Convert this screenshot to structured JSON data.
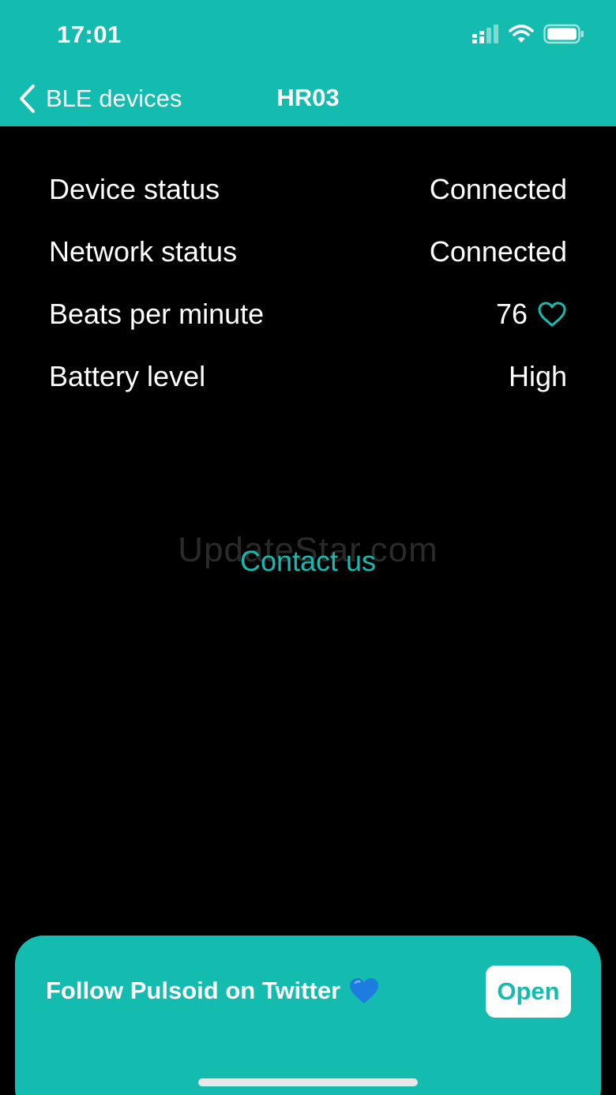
{
  "status_bar": {
    "time": "17:01",
    "icons": [
      "cellular-signal-icon",
      "wifi-icon",
      "battery-icon"
    ]
  },
  "nav": {
    "back_label": "BLE devices",
    "title": "HR03"
  },
  "info_rows": [
    {
      "label": "Device status",
      "value": "Connected"
    },
    {
      "label": "Network status",
      "value": "Connected"
    },
    {
      "label": "Beats per minute",
      "value": "76",
      "icon": "heart-outline-icon"
    },
    {
      "label": "Battery level",
      "value": "High"
    }
  ],
  "watermark": "UpdateStar.com",
  "contact_label": "Contact us",
  "banner": {
    "text": "Follow Pulsoid on Twitter",
    "icon": "blue-heart-icon",
    "button_label": "Open"
  },
  "colors": {
    "accent": "#14bcb0",
    "background": "#000000",
    "text": "#ffffff",
    "blue_heart": "#1e7be0"
  }
}
